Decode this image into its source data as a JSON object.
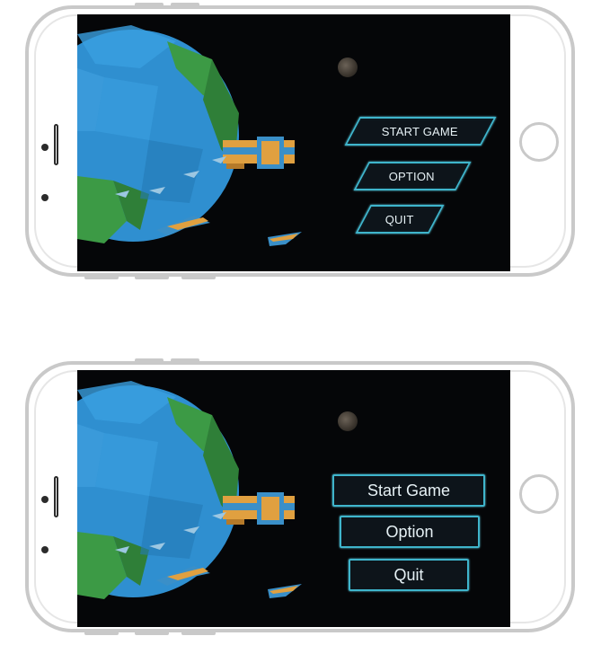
{
  "mockups": [
    {
      "variant": "slanted",
      "menu": {
        "start_game": "START GAME",
        "option": "OPTION",
        "quit": "QUIT"
      }
    },
    {
      "variant": "rectangular",
      "menu": {
        "start_game": "Start Game",
        "option": "Option",
        "quit": "Quit"
      }
    }
  ],
  "colors": {
    "button_border": "#3fb5cc",
    "button_fill": "#0e161c",
    "button_text": "#e6f1f5",
    "space_background": "#050608",
    "planet_ocean": "#2f8fd0",
    "planet_land": "#3c9a45",
    "ship_body": "#e0a040",
    "ship_accent": "#3a8fc8"
  },
  "icons": [
    "planet",
    "moon",
    "spaceship-mothership",
    "spaceship-fighter"
  ]
}
